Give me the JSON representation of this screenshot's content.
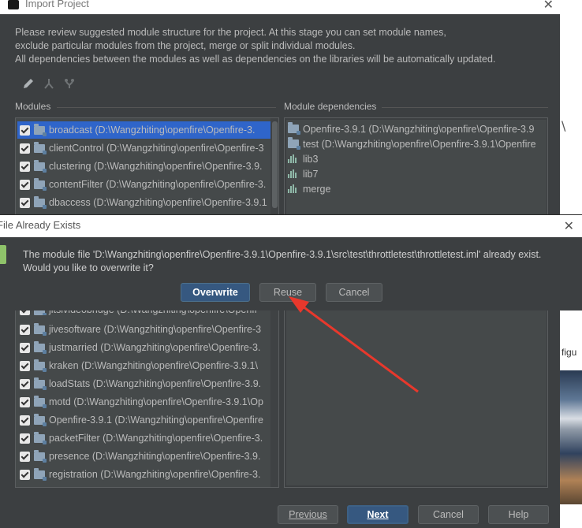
{
  "window": {
    "title": "Import Project"
  },
  "description": [
    "Please review suggested module structure for the project. At this stage you can set module names,",
    "exclude particular modules from the project, merge or split individual modules.",
    "All dependencies between the modules as well as dependencies on the libraries will be automatically updated."
  ],
  "modules_label": "Modules",
  "dependencies_label": "Module dependencies",
  "modules_top": [
    {
      "label": "broadcast (D:\\Wangzhiting\\openfire\\Openfire-3.",
      "checked": true,
      "selected": true
    },
    {
      "label": "clientControl (D:\\Wangzhiting\\openfire\\Openfire-3",
      "checked": true
    },
    {
      "label": "clustering (D:\\Wangzhiting\\openfire\\Openfire-3.9.",
      "checked": true
    },
    {
      "label": "contentFilter (D:\\Wangzhiting\\openfire\\Openfire-3.",
      "checked": true
    },
    {
      "label": "dbaccess (D:\\Wangzhiting\\openfire\\Openfire-3.9.1",
      "checked": true
    }
  ],
  "modules_bottom": [
    {
      "label": "jitsivideobridge (D:\\Wangzhiting\\openfire\\Openfi",
      "checked": true
    },
    {
      "label": "jivesoftware (D:\\Wangzhiting\\openfire\\Openfire-3",
      "checked": true
    },
    {
      "label": "justmarried (D:\\Wangzhiting\\openfire\\Openfire-3.",
      "checked": true
    },
    {
      "label": "kraken (D:\\Wangzhiting\\openfire\\Openfire-3.9.1\\",
      "checked": true
    },
    {
      "label": "loadStats (D:\\Wangzhiting\\openfire\\Openfire-3.9.",
      "checked": true
    },
    {
      "label": "motd (D:\\Wangzhiting\\openfire\\Openfire-3.9.1\\Op",
      "checked": true
    },
    {
      "label": "Openfire-3.9.1 (D:\\Wangzhiting\\openfire\\Openfire",
      "checked": true
    },
    {
      "label": "packetFilter (D:\\Wangzhiting\\openfire\\Openfire-3.",
      "checked": true
    },
    {
      "label": "presence (D:\\Wangzhiting\\openfire\\Openfire-3.9.",
      "checked": true
    },
    {
      "label": "registration (D:\\Wangzhiting\\openfire\\Openfire-3.",
      "checked": true
    }
  ],
  "dependencies": [
    {
      "label": "Openfire-3.9.1 (D:\\Wangzhiting\\openfire\\Openfire-3.9",
      "kind": "folder-icon"
    },
    {
      "label": "test (D:\\Wangzhiting\\openfire\\Openfire-3.9.1\\Openfire",
      "kind": "folder-icon"
    },
    {
      "label": "lib3",
      "kind": "library-icon"
    },
    {
      "label": "lib7",
      "kind": "library-icon"
    },
    {
      "label": "merge",
      "kind": "library-icon"
    }
  ],
  "overlay": {
    "title": "File Already Exists",
    "message_line1": "The module file 'D:\\Wangzhiting\\openfire\\Openfire-3.9.1\\Openfire-3.9.1\\src\\test\\throttletest\\throttletest.iml' already exist.",
    "message_line2": "Would you like to overwrite it?",
    "overwrite": "Overwrite",
    "reuse": "Reuse",
    "cancel": "Cancel"
  },
  "footer": {
    "previous": "Previous",
    "next": "Next",
    "cancel": "Cancel",
    "help": "Help"
  },
  "background_fragments": {
    "right_text": "figu"
  },
  "colors": {
    "accent": "#2f65ca",
    "primary_button": "#365880",
    "arrow": "#e8382c"
  }
}
